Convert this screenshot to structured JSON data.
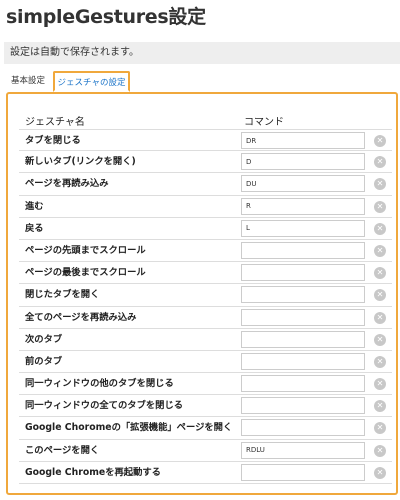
{
  "page": {
    "title": "simpleGestures設定",
    "notice": "設定は自動で保存されます。"
  },
  "tabs": [
    {
      "label": "基本設定",
      "active": false
    },
    {
      "label": "ジェスチャの設定",
      "active": true
    }
  ],
  "table": {
    "headers": {
      "name": "ジェスチャ名",
      "command": "コマンド"
    },
    "rows": [
      {
        "label": "タブを閉じる",
        "command": "DR"
      },
      {
        "label": "新しいタブ(リンクを開く)",
        "command": "D"
      },
      {
        "label": "ページを再読み込み",
        "command": "DU"
      },
      {
        "label": "進む",
        "command": "R"
      },
      {
        "label": "戻る",
        "command": "L"
      },
      {
        "label": "ページの先頭までスクロール",
        "command": ""
      },
      {
        "label": "ページの最後までスクロール",
        "command": ""
      },
      {
        "label": "閉じたタブを開く",
        "command": ""
      },
      {
        "label": "全てのページを再読み込み",
        "command": ""
      },
      {
        "label": "次のタブ",
        "command": ""
      },
      {
        "label": "前のタブ",
        "command": ""
      },
      {
        "label": "同一ウィンドウの他のタブを閉じる",
        "command": ""
      },
      {
        "label": "同一ウィンドウの全てのタブを閉じる",
        "command": ""
      },
      {
        "label": "Google Choromeの「拡張機能」ページを開く",
        "command": ""
      },
      {
        "label": "このページを開く",
        "command": "RDLU"
      },
      {
        "label": "Google Chromeを再起動する",
        "command": ""
      }
    ],
    "clear_glyph": "✕"
  },
  "colors": {
    "accent_border": "#f0a83c",
    "active_tab_text": "#1a73c8",
    "notice_bg": "#eeeeee",
    "clear_button": "#c8c8c8"
  },
  "icons": {
    "clear": "clear-circle-x-icon"
  }
}
